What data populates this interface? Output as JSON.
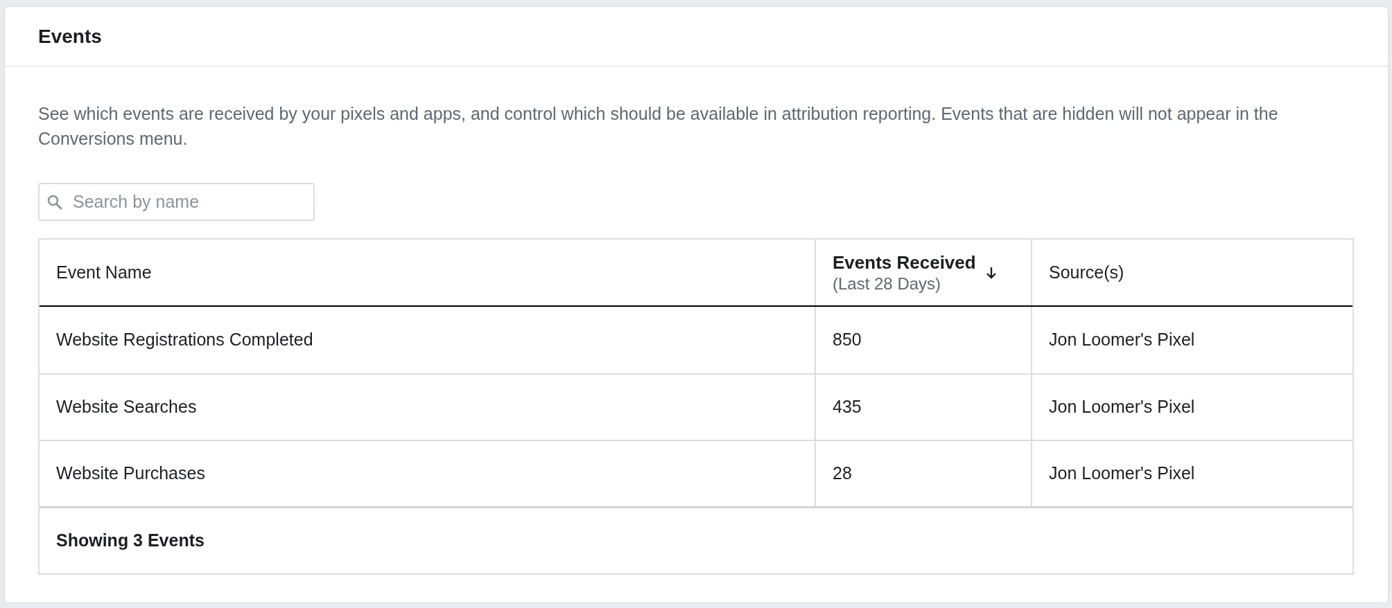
{
  "panel": {
    "title": "Events"
  },
  "description": "See which events are received by your pixels and apps, and control which should be available in attribution reporting. Events that are hidden will not appear in the Conversions menu.",
  "search": {
    "placeholder": "Search by name"
  },
  "table": {
    "columns": [
      {
        "label": "Event Name",
        "sorted": false
      },
      {
        "label": "Events Received",
        "sublabel": "(Last 28 Days)",
        "sorted": true
      },
      {
        "label": "Source(s)",
        "sorted": false
      }
    ],
    "rows": [
      [
        "Website Registrations Completed",
        "850",
        "Jon Loomer's Pixel"
      ],
      [
        "Website Searches",
        "435",
        "Jon Loomer's Pixel"
      ],
      [
        "Website Purchases",
        "28",
        "Jon Loomer's Pixel"
      ]
    ],
    "footer": "Showing 3 Events"
  }
}
